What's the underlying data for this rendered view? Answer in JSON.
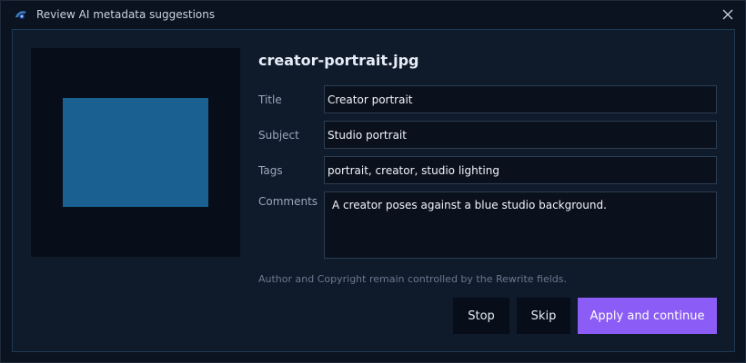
{
  "window": {
    "title": "Review AI metadata suggestions",
    "app_icon": "app-logo-icon",
    "close_icon": "close-icon"
  },
  "file": {
    "name": "creator-portrait.jpg",
    "preview_color": "#1a6090"
  },
  "fields": {
    "title_label": "Title",
    "title_value": "Creator portrait",
    "subject_label": "Subject",
    "subject_value": "Studio portrait",
    "tags_label": "Tags",
    "tags_value": "portrait, creator, studio lighting",
    "comments_label": "Comments",
    "comments_value": "A creator poses against a blue studio background."
  },
  "note": "Author and Copyright remain controlled by the Rewrite fields.",
  "buttons": {
    "stop": "Stop",
    "skip": "Skip",
    "apply": "Apply and continue"
  },
  "colors": {
    "accent": "#8b5cf6",
    "background": "#0b1220",
    "panel": "#0f1a2b"
  }
}
